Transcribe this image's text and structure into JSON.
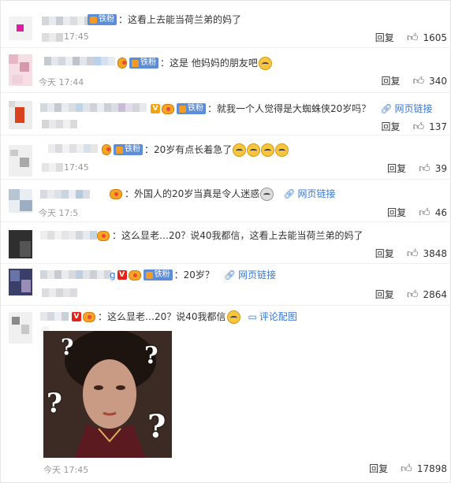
{
  "comments": [
    {
      "text": "：这看上去能当荷兰弟的妈了",
      "time": "17:45",
      "reply": "回复",
      "likes": "1605",
      "badge": "铁粉"
    },
    {
      "text": "：这是 他妈妈的朋友吧",
      "time": "今天 17:44",
      "reply": "回复",
      "likes": "340",
      "badge": "铁粉"
    },
    {
      "text": "：就我一个人觉得是大蜘蛛侠20岁吗？",
      "time": "",
      "reply": "回复",
      "likes": "137",
      "badge": "铁粉",
      "link": "网页链接"
    },
    {
      "text": "：20岁有点长着急了",
      "time": "17:45",
      "reply": "回复",
      "likes": "39",
      "badge": "铁粉"
    },
    {
      "text": "：外国人的20岁当真是令人迷惑",
      "time": "今天 17:5",
      "reply": "回复",
      "likes": "46",
      "link": "网页链接"
    },
    {
      "text": "：这么显老…20？说40我都信，这看上去能当荷兰弟的妈了",
      "time": "",
      "reply": "回复",
      "likes": "3848"
    },
    {
      "text": "：20岁？",
      "time": "",
      "reply": "回复",
      "likes": "2864",
      "badge": "铁粉",
      "link": "网页链接",
      "name_tail": "g"
    },
    {
      "text": "：这么显老…20？说40我都信",
      "time": "今天 17:45",
      "reply": "回复",
      "likes": "17898",
      "link": "评论配图"
    }
  ]
}
